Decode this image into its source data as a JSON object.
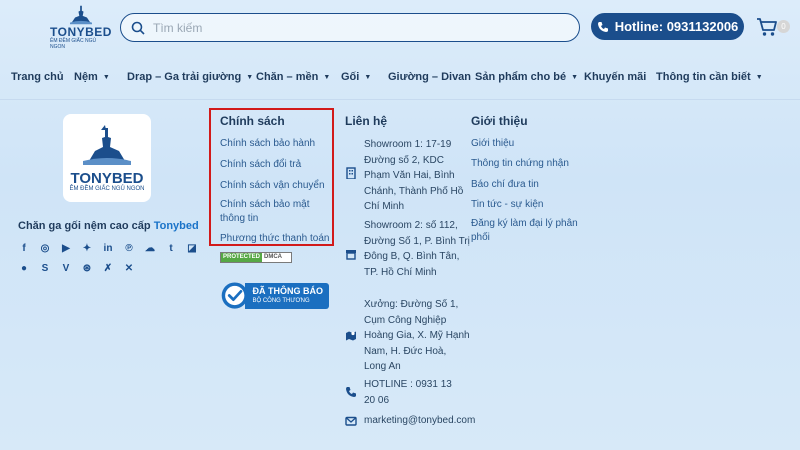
{
  "header": {
    "logo_text": "TONYBED",
    "logo_sub": "ÊM ĐỀM GIẤC NGỦ NGON",
    "search_placeholder": "Tìm kiếm",
    "hotline": "Hotline: 0931132006",
    "cart_count": "0"
  },
  "nav": {
    "items": [
      {
        "label": "Trang chủ"
      },
      {
        "label": "Nệm"
      },
      {
        "label": "Drap – Ga trải giường"
      },
      {
        "label": "Chăn – mền"
      },
      {
        "label": "Gối"
      },
      {
        "label": "Giường – Divan"
      },
      {
        "label": "Sản phẩm cho bé"
      },
      {
        "label": "Khuyến mãi"
      },
      {
        "label": "Thông tin cần biết"
      }
    ]
  },
  "brand": {
    "logo_text": "TONYBED",
    "logo_sub": "ÊM ĐỀM GIẤC NGỦ NGON",
    "tagline_prefix": "Chăn ga gối nệm cao cấp",
    "tagline_brand": "Tonybed",
    "socials": [
      "facebook-icon",
      "instagram-icon",
      "youtube-icon",
      "twitter-icon",
      "linkedin-icon",
      "pinterest-icon",
      "soundcloud-icon",
      "tumblr-icon",
      "delicious-icon",
      "reddit-icon",
      "skype-icon",
      "vimeo-icon",
      "dribbble-icon",
      "xing-icon",
      "xing-alt-icon"
    ]
  },
  "policy": {
    "title": "Chính sách",
    "links": [
      "Chính sách bảo hành",
      "Chính sách đổi trả",
      "Chính sách vận chuyển",
      "Chính sách bảo mật thông tin",
      "Phương thức thanh toán"
    ],
    "dmca_protected": "PROTECTED",
    "dmca_label": "DMCA",
    "bct_title": "ĐÃ THÔNG BÁO",
    "bct_sub": "BỘ CÔNG THƯƠNG"
  },
  "contact": {
    "title": "Liên hệ",
    "showroom1": "Showroom 1: 17-19 Đường số 2, KDC Phạm Văn Hai, Bình Chánh, Thành Phố Hồ Chí Minh",
    "showroom2": "Showroom 2: số 112, Đường Số 1, P. Bình Trị Đông B, Q. Bình Tân, TP. Hồ Chí Minh",
    "factory": "Xưởng: Đường Số 1, Cụm Công Nghiệp Hoàng Gia, X. Mỹ Hạnh Nam, H. Đức Hoà, Long An",
    "hotline": "HOTLINE : 0931 13 20 06",
    "email": "marketing@tonybed.com"
  },
  "about": {
    "title": "Giới thiệu",
    "links": [
      "Giới thiệu",
      "Thông tin chứng nhận",
      "Báo chí đưa tin",
      "Tin tức - sự kiện",
      "Đăng ký làm đại lý phân phối"
    ]
  }
}
